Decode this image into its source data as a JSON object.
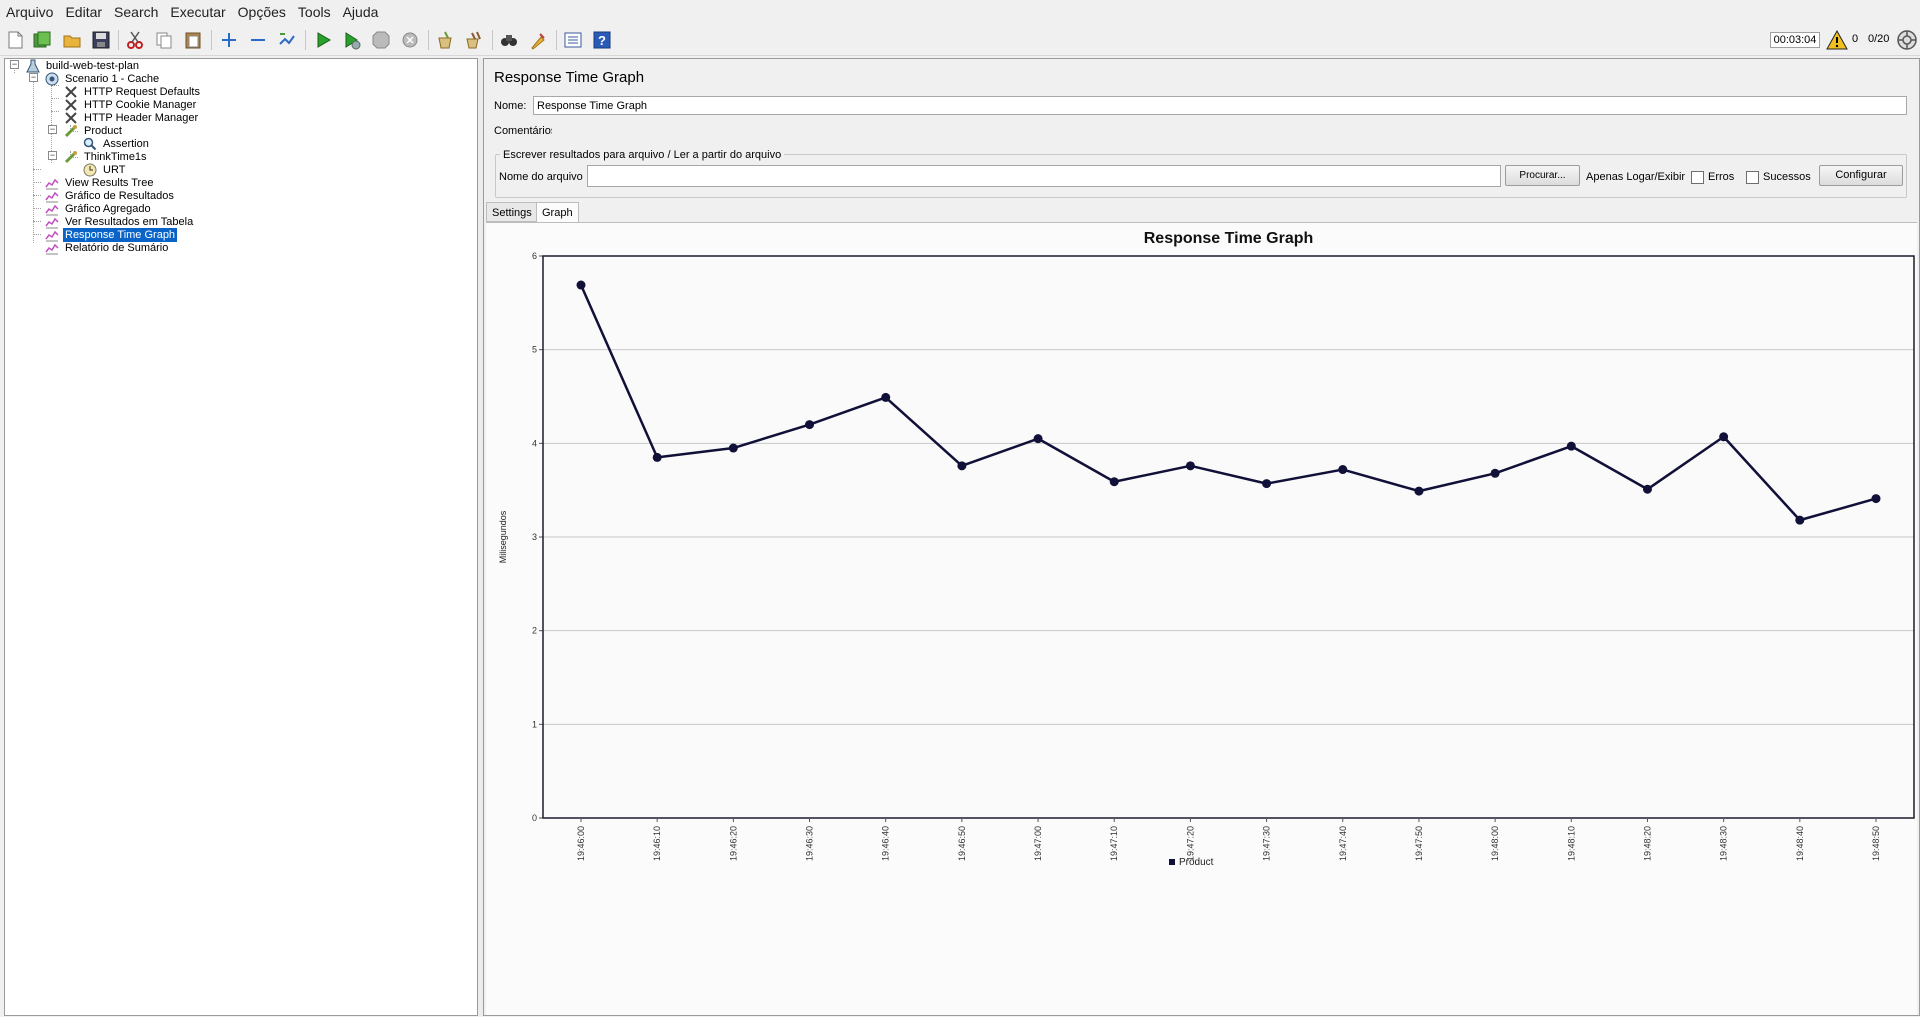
{
  "menu": [
    "Arquivo",
    "Editar",
    "Search",
    "Executar",
    "Opções",
    "Tools",
    "Ajuda"
  ],
  "toolbar": {
    "buttons": [
      "new-icon",
      "templates-icon",
      "open-icon",
      "save-icon",
      "cut-icon",
      "copy-icon",
      "paste-icon",
      "expand-icon",
      "collapse-icon",
      "toggle-icon",
      "start-icon",
      "start-no-pause-icon",
      "stop-icon",
      "shutdown-icon",
      "clear-icon",
      "clear-all-icon",
      "search-icon",
      "reset-search-icon",
      "function-helper-icon",
      "help-icon"
    ],
    "timer": "00:03:04",
    "warning_count": "0",
    "threads": "0/20"
  },
  "tree": [
    {
      "label": "build-web-test-plan",
      "icon": "testplan-icon"
    },
    {
      "label": "Scenario 1 - Cache",
      "icon": "thread-group-icon"
    },
    {
      "label": "HTTP Request Defaults",
      "icon": "config-icon"
    },
    {
      "label": "HTTP Cookie Manager",
      "icon": "config-icon"
    },
    {
      "label": "HTTP Header Manager",
      "icon": "config-icon"
    },
    {
      "label": "Product",
      "icon": "sampler-icon"
    },
    {
      "label": "Assertion",
      "icon": "assertion-icon"
    },
    {
      "label": "ThinkTime1s",
      "icon": "sampler-icon"
    },
    {
      "label": "URT",
      "icon": "timer-icon"
    },
    {
      "label": "View Results Tree",
      "icon": "listener-icon"
    },
    {
      "label": "Gráfico de Resultados",
      "icon": "listener-icon"
    },
    {
      "label": "Gráfico Agregado",
      "icon": "listener-icon"
    },
    {
      "label": "Ver Resultados em Tabela",
      "icon": "listener-icon"
    },
    {
      "label": "Response Time Graph",
      "icon": "listener-icon",
      "selected": true
    },
    {
      "label": "Relatório de Sumário",
      "icon": "listener-icon"
    }
  ],
  "panel": {
    "title": "Response Time Graph",
    "name_label": "Nome:",
    "name_value": "Response Time Graph",
    "comments_label": "Comentários:",
    "file_group_title": "Escrever resultados para arquivo / Ler a partir do arquivo",
    "file_label": "Nome do arquivo",
    "file_value": "",
    "browse_label": "Procurar...",
    "log_only_label": "Apenas Logar/Exibir",
    "errors_label": "Erros",
    "successes_label": "Sucessos",
    "configure_label": "Configurar",
    "tabs": [
      "Settings",
      "Graph"
    ],
    "active_tab": "Graph"
  },
  "chart_data": {
    "type": "line",
    "title": "Response Time Graph",
    "xlabel": "",
    "ylabel": "Milisegundos",
    "ylim": [
      0,
      6
    ],
    "yticks": [
      "0",
      "1",
      "2",
      "3",
      "4",
      "5",
      "6"
    ],
    "grid": true,
    "legend_position": "bottom",
    "categories": [
      "19:46:00",
      "19:46:10",
      "19:46:20",
      "19:46:30",
      "19:46:40",
      "19:46:50",
      "19:47:00",
      "19:47:10",
      "19:47:20",
      "19:47:30",
      "19:47:40",
      "19:47:50",
      "19:48:00",
      "19:48:10",
      "19:48:20",
      "19:48:30",
      "19:48:40",
      "19:48:50"
    ],
    "series": [
      {
        "name": "Product",
        "color": "#101038",
        "values": [
          5.69,
          3.85,
          3.95,
          4.2,
          4.49,
          3.76,
          4.05,
          3.59,
          3.76,
          3.57,
          3.72,
          3.49,
          3.68,
          3.97,
          3.51,
          4.07,
          3.18,
          3.41
        ]
      }
    ]
  }
}
